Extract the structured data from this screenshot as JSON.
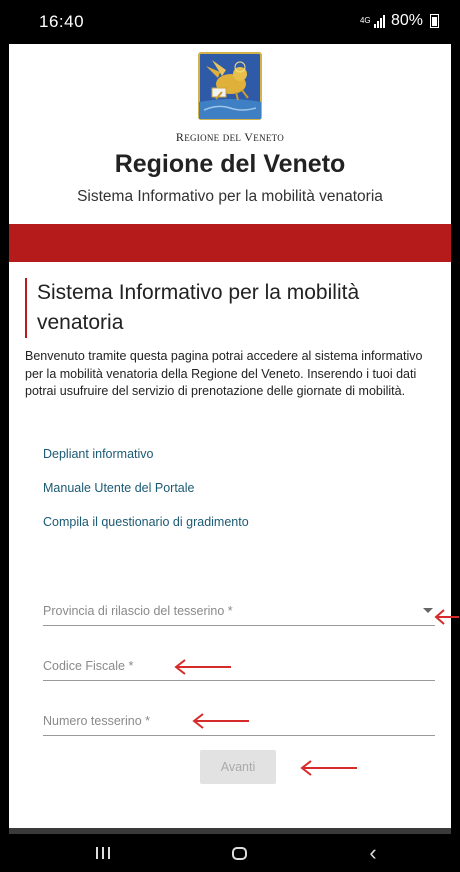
{
  "status_bar": {
    "time": "16:40",
    "network": "4G",
    "battery": "80%"
  },
  "header": {
    "region_small_cap1": "R",
    "region_small_rest1": "EGIONE",
    "region_small_del": "DEL",
    "region_small_cap2": "V",
    "region_small_rest2": "ENETO",
    "title": "Regione del Veneto",
    "subtitle": "Sistema Informativo per la mobilità venatoria"
  },
  "main": {
    "heading": "Sistema Informativo per la mobilità venatoria",
    "intro": "Benvenuto tramite questa pagina potrai accedere al sistema informativo per la mobilità venatoria della Regione del Veneto. Inserendo i tuoi dati potrai usufruire del servizio di prenotazione delle giornate di mobilità.",
    "links": [
      "Depliant informativo",
      "Manuale Utente del Portale",
      "Compila il questionario di gradimento"
    ]
  },
  "form": {
    "province": {
      "placeholder": "Provincia di rilascio del tesserino *",
      "value": ""
    },
    "fiscal_code": {
      "placeholder": "Codice Fiscale *",
      "value": ""
    },
    "card_number": {
      "placeholder": "Numero tesserino *",
      "value": ""
    },
    "submit_label": "Avanti"
  },
  "colors": {
    "brand_red": "#b51b1b",
    "link": "#1b5a73",
    "annotation_arrow": "#d62b2b"
  },
  "icons": [
    "signal-icon",
    "battery-icon",
    "region-crest-icon",
    "dropdown-caret-icon",
    "arrow-annotation-icon",
    "recent-apps-icon",
    "home-icon",
    "back-icon"
  ]
}
